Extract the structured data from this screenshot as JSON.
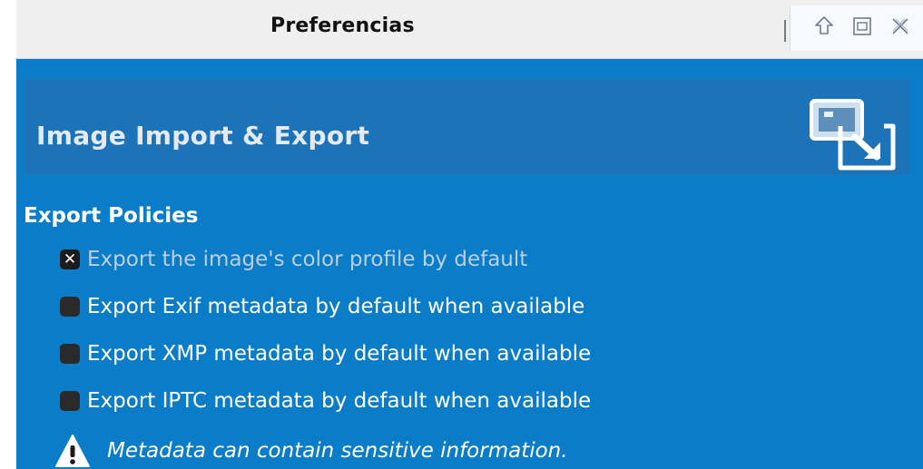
{
  "window": {
    "title": "Preferencias",
    "buttons": {
      "shade_icon": "arrow-up-outline-icon",
      "maximize_icon": "maximize-square-icon",
      "close_icon": "close-x-icon"
    }
  },
  "page": {
    "title": "Image Import & Export",
    "icon": "image-import-export-icon"
  },
  "export_policies": {
    "heading": "Export Policies",
    "options": [
      {
        "label": "Export the image's color profile by default",
        "checked": true
      },
      {
        "label": "Export Exif metadata by default when available",
        "checked": false
      },
      {
        "label": "Export XMP metadata by default when available",
        "checked": false
      },
      {
        "label": "Export IPTC metadata by default when available",
        "checked": false
      }
    ],
    "warning": {
      "icon": "warning-triangle-icon",
      "text": "Metadata can contain sensitive information."
    }
  },
  "colors": {
    "panel_bg": "#0b7cc7",
    "header_bg": "#1d73b8",
    "titlebar_bg": "#efefef"
  }
}
